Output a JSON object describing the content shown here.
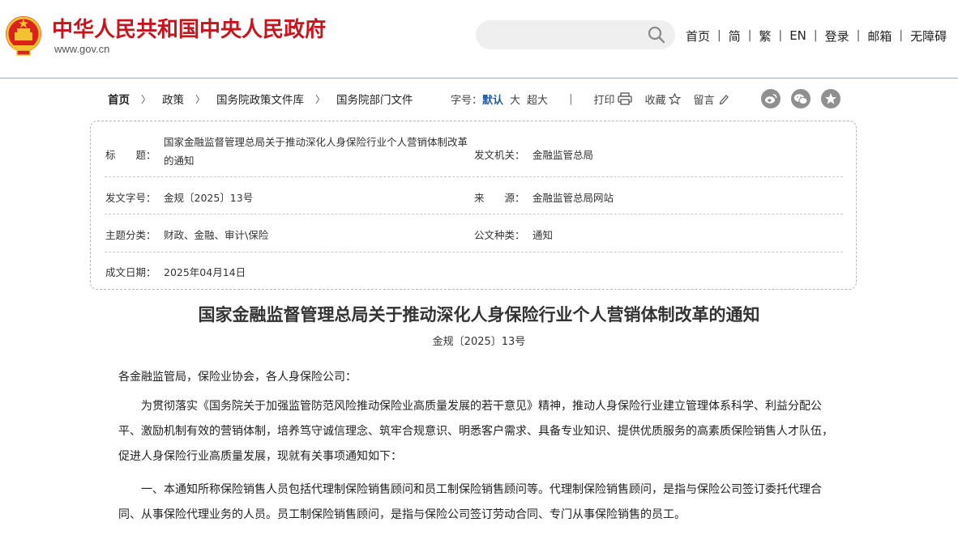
{
  "header": {
    "site_title": "中华人民共和国中央人民政府",
    "site_url": "www.gov.cn",
    "search_placeholder": "",
    "nav": [
      "首页",
      "简",
      "繁",
      "EN",
      "登录",
      "邮箱",
      "无障碍"
    ]
  },
  "breadcrumb": [
    "首页",
    "政策",
    "国务院政策文件库",
    "国务院部门文件"
  ],
  "tools": {
    "font_label": "字号：",
    "font_default": "默认",
    "font_large": "大",
    "font_xlarge": "超大",
    "print": "打印",
    "favorite": "收藏",
    "comment": "留言"
  },
  "share_icons": [
    "weibo-icon",
    "wechat-icon",
    "star-icon"
  ],
  "info": {
    "title_label": "标　　题：",
    "title_value": "国家金融监督管理总局关于推动深化人身保险行业个人营销体制改革的通知",
    "issuer_label": "发文机关：",
    "issuer_value": "金融监管总局",
    "docno_label": "发文字号：",
    "docno_value": "金规〔2025〕13号",
    "source_label": "来　　源：",
    "source_value": "金融监管总局网站",
    "topic_label": "主题分类：",
    "topic_value": "财政、金融、审计\\保险",
    "type_label": "公文种类：",
    "type_value": "通知",
    "date_label": "成文日期：",
    "date_value": "2025年04月14日"
  },
  "article": {
    "title": "国家金融监督管理总局关于推动深化人身保险行业个人营销体制改革的通知",
    "doc_number": "金规〔2025〕13号",
    "greeting": "各金融监管局，保险业协会，各人身保险公司：",
    "paragraph1": "为贯彻落实《国务院关于加强监管防范风险推动保险业高质量发展的若干意见》精神，推动人身保险行业建立管理体系科学、利益分配公平、激励机制有效的营销体制，培养笃守诚信理念、筑牢合规意识、明悉客户需求、具备专业知识、提供优质服务的高素质保险销售人才队伍，促进人身保险行业高质量发展，现就有关事项通知如下：",
    "paragraph2": "一、本通知所称保险销售人员包括代理制保险销售顾问和员工制保险销售顾问等。代理制保险销售顾问，是指与保险公司签订委托代理合同、从事保险代理业务的人员。员工制保险销售顾问，是指与保险公司签订劳动合同、专门从事保险销售的员工。"
  },
  "colors": {
    "brand_red": "#c5161d",
    "link_blue": "#1e5ba8",
    "icon_gray": "#8f8f8f"
  }
}
